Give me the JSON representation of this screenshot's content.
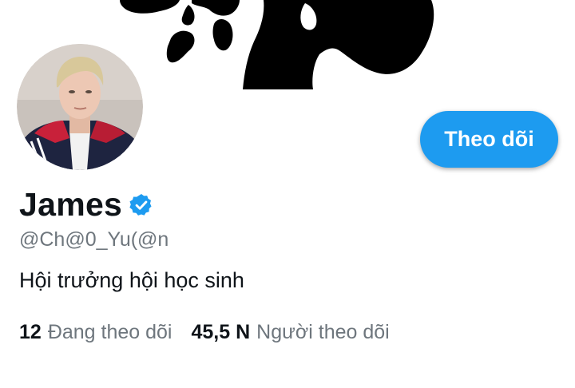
{
  "profile": {
    "name": "James",
    "handle": "@Ch@0_Yu(@n",
    "bio": "Hội trưởng hội học sinh",
    "verified": true,
    "verified_icon": "verified-badge-icon"
  },
  "actions": {
    "follow_label": "Theo dõi"
  },
  "stats": {
    "following_count": "12",
    "following_label": "Đang theo dõi",
    "followers_count": "45,5 N",
    "followers_label": "Người theo dõi"
  },
  "colors": {
    "accent": "#1d9bf0",
    "text_primary": "#0f1419",
    "text_secondary": "#6e767d",
    "banner_blobs": "#000000"
  }
}
